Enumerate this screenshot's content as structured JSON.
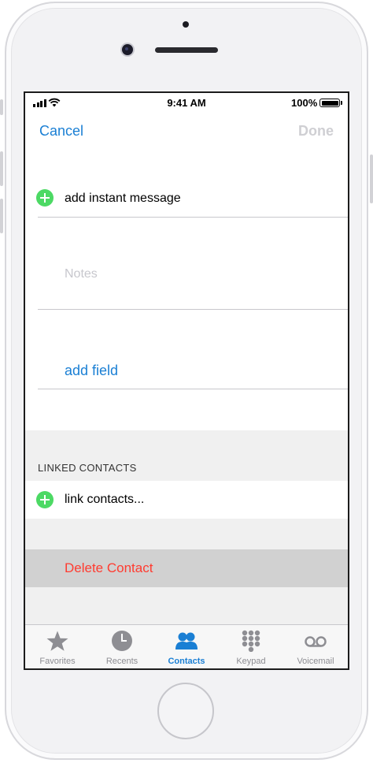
{
  "status_bar": {
    "time": "9:41 AM",
    "battery": "100%"
  },
  "nav": {
    "cancel": "Cancel",
    "done": "Done"
  },
  "form": {
    "add_instant_message": "add instant message",
    "notes_placeholder": "Notes",
    "add_field": "add field"
  },
  "linked_contacts": {
    "header": "LINKED CONTACTS",
    "link_label": "link contacts..."
  },
  "delete_contact": "Delete Contact",
  "tabs": [
    {
      "label": "Favorites",
      "icon": "star-icon",
      "active": false
    },
    {
      "label": "Recents",
      "icon": "clock-icon",
      "active": false
    },
    {
      "label": "Contacts",
      "icon": "contacts-icon",
      "active": true
    },
    {
      "label": "Keypad",
      "icon": "keypad-icon",
      "active": false
    },
    {
      "label": "Voicemail",
      "icon": "voicemail-icon",
      "active": false
    }
  ],
  "colors": {
    "accent": "#1a7fd4",
    "add_green": "#4cd964",
    "destructive": "#ff3b30",
    "tab_inactive": "#8e8e93"
  }
}
